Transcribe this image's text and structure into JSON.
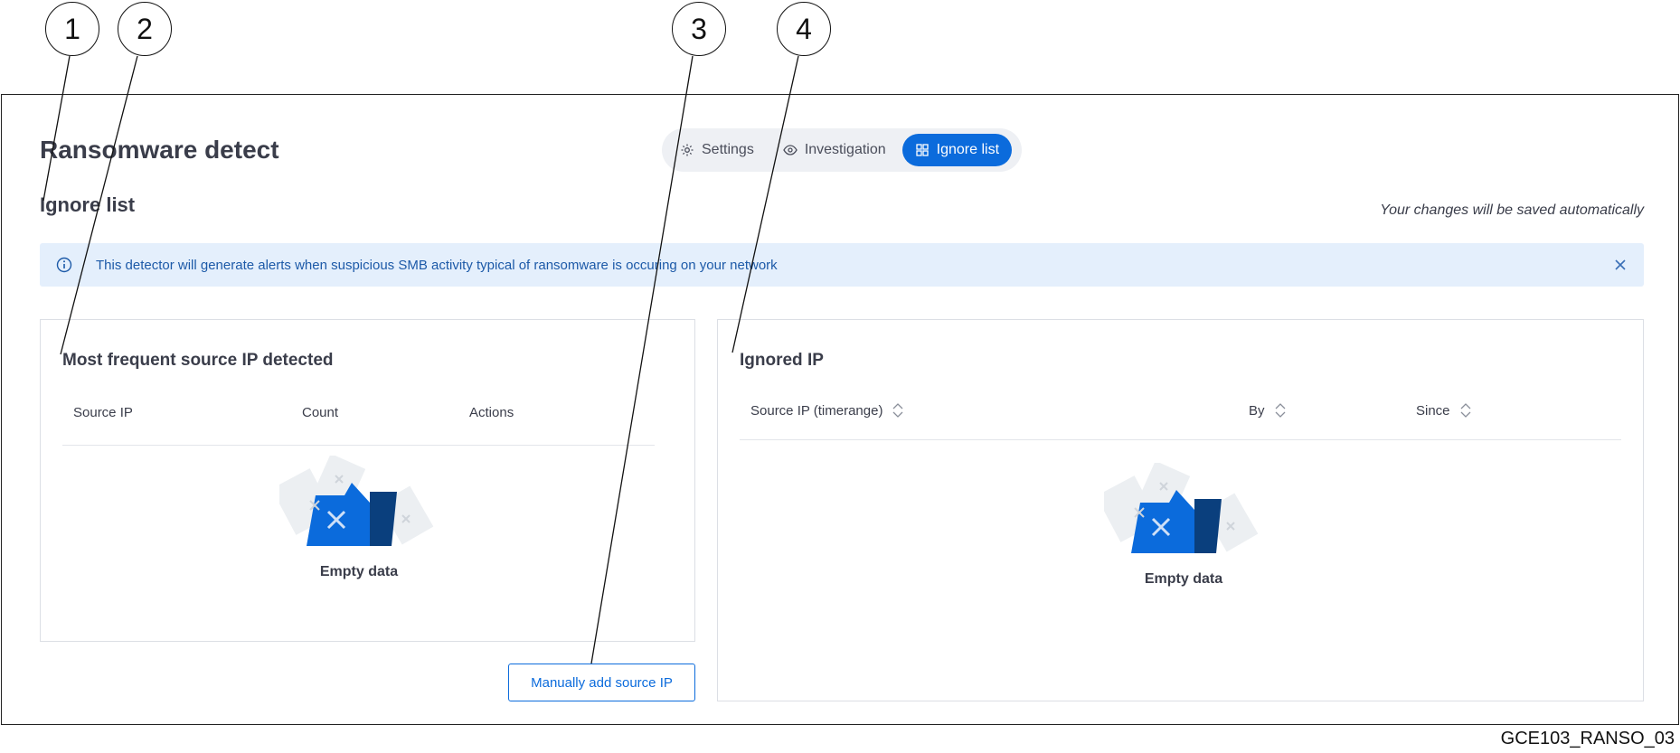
{
  "page": {
    "title": "Ransomware detect",
    "section_title": "Ignore list",
    "autosave_note": "Your changes will be saved automatically"
  },
  "tabs": [
    {
      "label": "Settings",
      "icon": "gear-icon",
      "active": false
    },
    {
      "label": "Investigation",
      "icon": "eye-icon",
      "active": false
    },
    {
      "label": "Ignore list",
      "icon": "grid-icon",
      "active": true
    }
  ],
  "banner": {
    "text": "This detector will generate alerts when suspicious SMB activity typical of ransomware is occuring on your network",
    "icon": "info-icon",
    "close_icon": "close-icon"
  },
  "left_card": {
    "title": "Most frequent source IP detected",
    "columns": [
      "Source IP",
      "Count",
      "Actions"
    ],
    "rows": [],
    "empty_label": "Empty data"
  },
  "right_card": {
    "title": "Ignored IP",
    "columns": [
      "Source IP (timerange)",
      "By",
      "Since"
    ],
    "rows": [],
    "empty_label": "Empty data"
  },
  "actions": {
    "add_button": "Manually add source IP"
  },
  "callouts": [
    "1",
    "2",
    "3",
    "4"
  ],
  "figure_ref": "GCE103_RANSO_03",
  "colors": {
    "accent": "#0b6bdc",
    "banner_bg": "#e4effc",
    "banner_text": "#1d5aa8",
    "tab_track": "#eef0f4"
  }
}
